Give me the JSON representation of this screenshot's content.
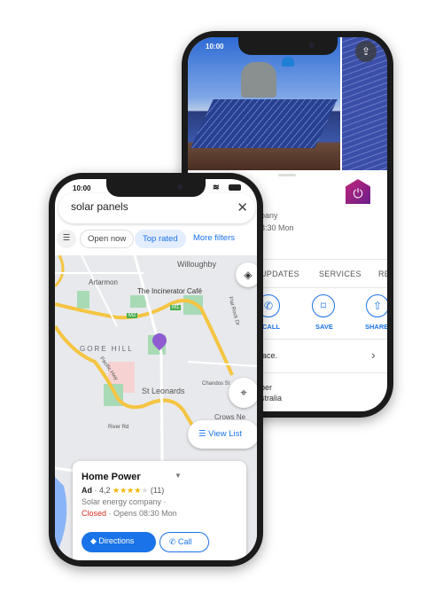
{
  "back_phone": {
    "time": "10:00",
    "partial_rating": ")",
    "partial_category": "pany",
    "partial_hours": "8:30 Mon",
    "partial_icon_text": "",
    "tabs": [
      "UPDATES",
      "SERVICES",
      "RE"
    ],
    "actions": [
      {
        "label": "CALL",
        "icon": "phone-icon"
      },
      {
        "label": "SAVE",
        "icon": "bookmark-icon"
      },
      {
        "label": "SHARE",
        "icon": "share-icon"
      }
    ],
    "row_text": "lace.",
    "address_line1": "ber",
    "address_line2": "stralia",
    "brand_color": "#a3237f"
  },
  "front_phone": {
    "time": "10:00",
    "search": {
      "value": "solar panels"
    },
    "filters": {
      "open_now": "Open now",
      "top_rated": "Top rated",
      "more": "More filters"
    },
    "map_labels": {
      "willoughby": "Willoughby",
      "artarmon": "Artarmon",
      "cafe": "The Incinerator Café",
      "m1": "M1",
      "m2": "M2",
      "gore_hill": "GORE HILL",
      "pacific_hwy": "Pacific Hwy",
      "st_leonards": "St Leonards",
      "chandos": "Chandos St",
      "crows_nest": "Crows Ne",
      "river_rd": "River Rd",
      "flat_rock": "Flat Rock Dr"
    },
    "view_list": "View List",
    "card": {
      "name": "Home Power",
      "ad": "Ad",
      "rating": "4,2",
      "stars": 4,
      "reviews": "(11)",
      "category": "Solar energy company ·",
      "status": "Closed",
      "hours": "· Opens 08:30 Mon",
      "directions": "Directions",
      "call": "Call"
    },
    "accent_color": "#1a73e8",
    "pin_color": "#8e5bd1"
  }
}
